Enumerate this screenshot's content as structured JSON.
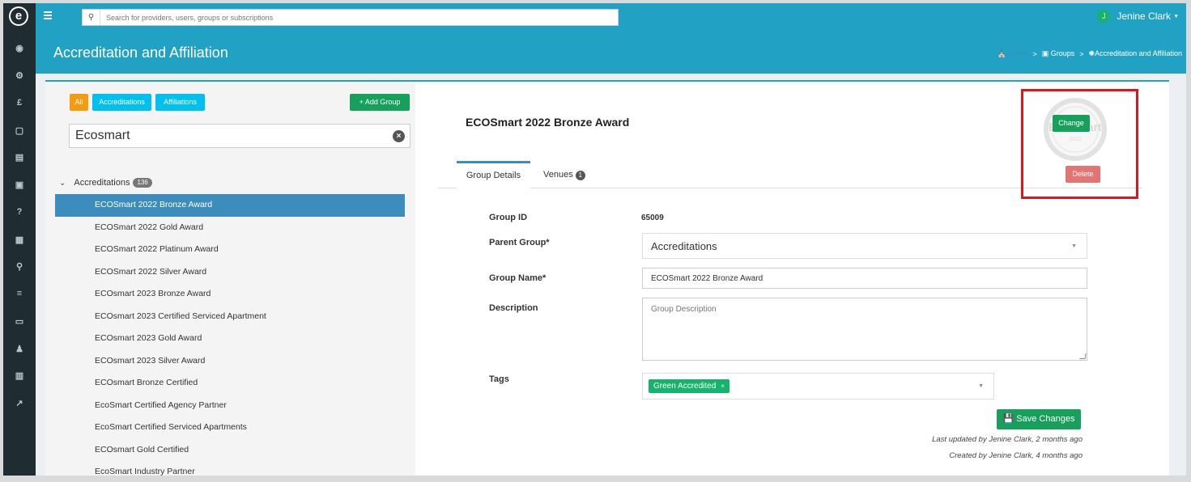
{
  "app": {
    "logo_letter": "e",
    "search_placeholder": "Search for providers, users, groups or subscriptions",
    "user_initial": "J",
    "user_name": "Jenine Clark"
  },
  "sidebar": {
    "icons": [
      "dashboard-icon",
      "cogs-icon",
      "pound-icon",
      "file-icon",
      "list-icon",
      "groups-icon",
      "help-icon",
      "calendar-icon",
      "map-marker-icon",
      "database-icon",
      "money-icon",
      "user-icon",
      "building-icon",
      "external-link-icon"
    ],
    "glyphs": [
      "◉",
      "⚙",
      "£",
      "▢",
      "▤",
      "▣",
      "?",
      "▦",
      "⚲",
      "≡",
      "▭",
      "♟",
      "▥",
      "↗"
    ]
  },
  "header": {
    "title": "Accreditation and Affiliation",
    "breadcrumb": {
      "home": "Home",
      "groups": "Groups",
      "current": "Accreditation and Affiliation",
      "separator": ">"
    }
  },
  "filters": {
    "all": "All",
    "accreditations": "Accreditations",
    "affiliations": "Affiliations",
    "add_group": "+ Add Group"
  },
  "group_search": {
    "value": "Ecosmart",
    "clear": "×"
  },
  "tree": {
    "root_label": "Accreditations",
    "root_count": "136",
    "items": [
      "ECOSmart 2022 Bronze Award",
      "ECOSmart 2022 Gold Award",
      "ECOSmart 2022 Platinum Award",
      "ECOSmart 2022 Silver Award",
      "ECOsmart 2023 Bronze Award",
      "ECOsmart 2023 Certified Serviced Apartment",
      "ECOsmart 2023 Gold Award",
      "ECOsmart 2023 Silver Award",
      "ECOsmart Bronze Certified",
      "EcoSmart Certified Agency Partner",
      "EcoSmart Certified Serviced Apartments",
      "ECOsmart Gold Certified",
      "EcoSmart Industry Partner"
    ],
    "active_index": 0
  },
  "detail": {
    "title": "ECOSmart 2022 Bronze Award",
    "tabs": {
      "group_details": "Group Details",
      "venues": "Venues",
      "venues_count": "1"
    },
    "labels": {
      "group_id": "Group ID",
      "parent_group": "Parent Group*",
      "group_name": "Group Name*",
      "description": "Description",
      "tags": "Tags"
    },
    "values": {
      "group_id": "65009",
      "parent_group": "Accreditations",
      "group_name": "ECOSmart 2022 Bronze Award",
      "description_placeholder": "Group Description",
      "tag": "Green Accredited",
      "tag_remove": "×"
    },
    "save_label": "Save Changes",
    "last_updated": "Last updated by Jenine Clark, 2 months ago",
    "created": "Created by Jenine Clark, 4 months ago"
  },
  "image_widget": {
    "watermark_text": "EcoSmart",
    "watermark_year": "2022",
    "change_label": "Change",
    "delete_label": "Delete"
  },
  "colors": {
    "topbar": "#21a2c4",
    "sidebar": "#1f2d33",
    "active_item": "#3c8dbc",
    "green_button": "#16a05b",
    "orange_filter": "#f39c12",
    "cyan_filter": "#00c0ef",
    "delete_button": "#e06666",
    "highlight": "#e0141b"
  }
}
